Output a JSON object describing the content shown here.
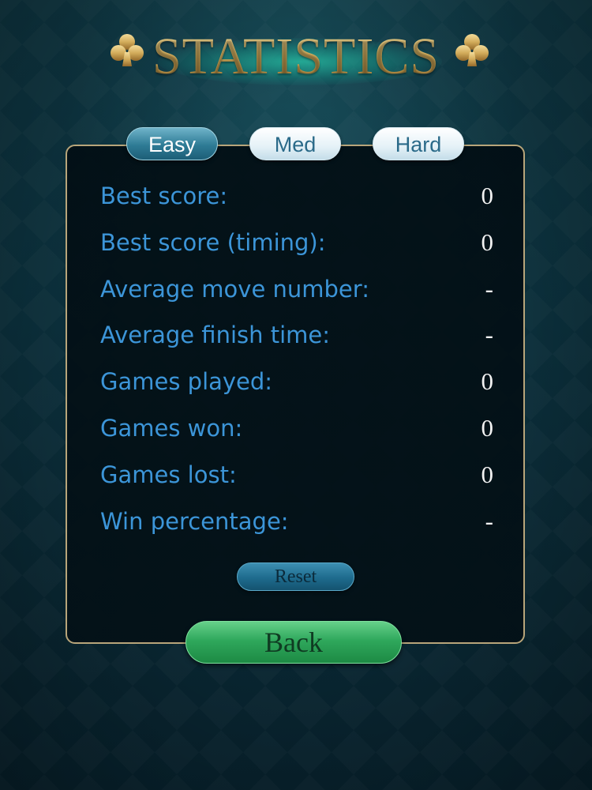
{
  "title": "STATISTICS",
  "colors": {
    "background": "#0c3340",
    "title_gold": "#d8b260",
    "label_blue": "#3c95d8",
    "tab_active": "#2e7b95",
    "reset_button": "#1e6b8d",
    "back_button": "#2fa85c",
    "panel_border": "#b8a57a"
  },
  "tabs": [
    {
      "label": "Easy",
      "selected": true
    },
    {
      "label": "Med",
      "selected": false
    },
    {
      "label": "Hard",
      "selected": false
    }
  ],
  "stats": [
    {
      "label": "Best score:",
      "value": "0"
    },
    {
      "label": "Best score (timing):",
      "value": "0"
    },
    {
      "label": "Average move number:",
      "value": "-"
    },
    {
      "label": "Average finish time:",
      "value": "-"
    },
    {
      "label": "Games played:",
      "value": "0"
    },
    {
      "label": "Games won:",
      "value": "0"
    },
    {
      "label": "Games lost:",
      "value": "0"
    },
    {
      "label": "Win percentage:",
      "value": "-"
    }
  ],
  "reset_label": "Reset",
  "back_label": "Back",
  "icons": {
    "left": "club-icon",
    "right": "club-icon"
  }
}
